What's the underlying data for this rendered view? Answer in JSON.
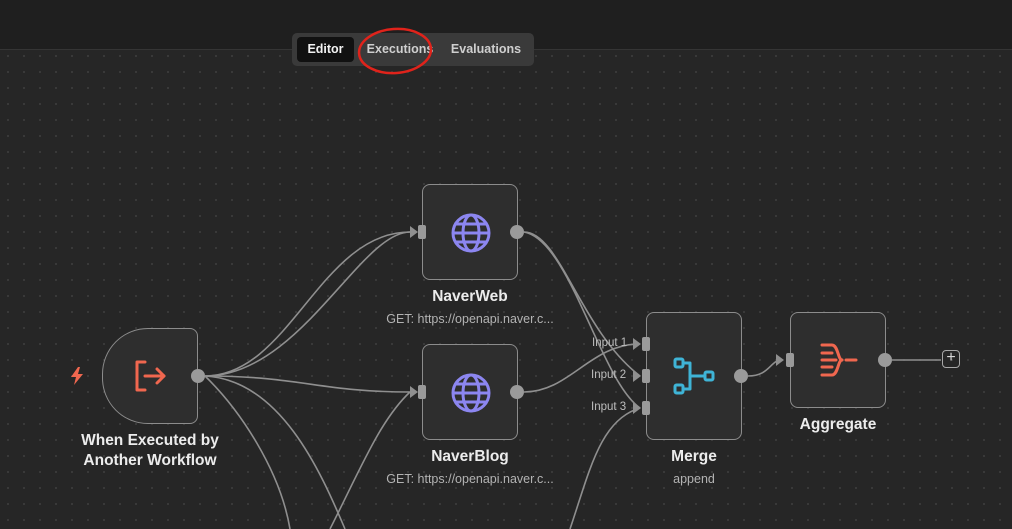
{
  "tabs": [
    {
      "label": "Editor",
      "active": true
    },
    {
      "label": "Executions",
      "active": false
    },
    {
      "label": "Evaluations",
      "active": false
    }
  ],
  "nodes": {
    "trigger": {
      "title_line1": "When Executed by",
      "title_line2": "Another Workflow",
      "icon": "sign-out-arrow-icon"
    },
    "naverweb": {
      "title": "NaverWeb",
      "subtitle": "GET: https://openapi.naver.c...",
      "icon": "globe-icon"
    },
    "naverblog": {
      "title": "NaverBlog",
      "subtitle": "GET: https://openapi.naver.c...",
      "icon": "globe-icon"
    },
    "merge": {
      "title": "Merge",
      "subtitle": "append",
      "icon": "merge-icon",
      "inputs": [
        "Input 1",
        "Input 2",
        "Input 3"
      ]
    },
    "aggregate": {
      "title": "Aggregate",
      "icon": "aggregate-icon"
    }
  },
  "add_node": {
    "symbol": "+"
  },
  "colors": {
    "trigger_accent": "#f0674f",
    "globe": "#8c86f0",
    "merge": "#3fb4d6",
    "aggregate": "#f0674f",
    "annotation": "#e0231b"
  }
}
